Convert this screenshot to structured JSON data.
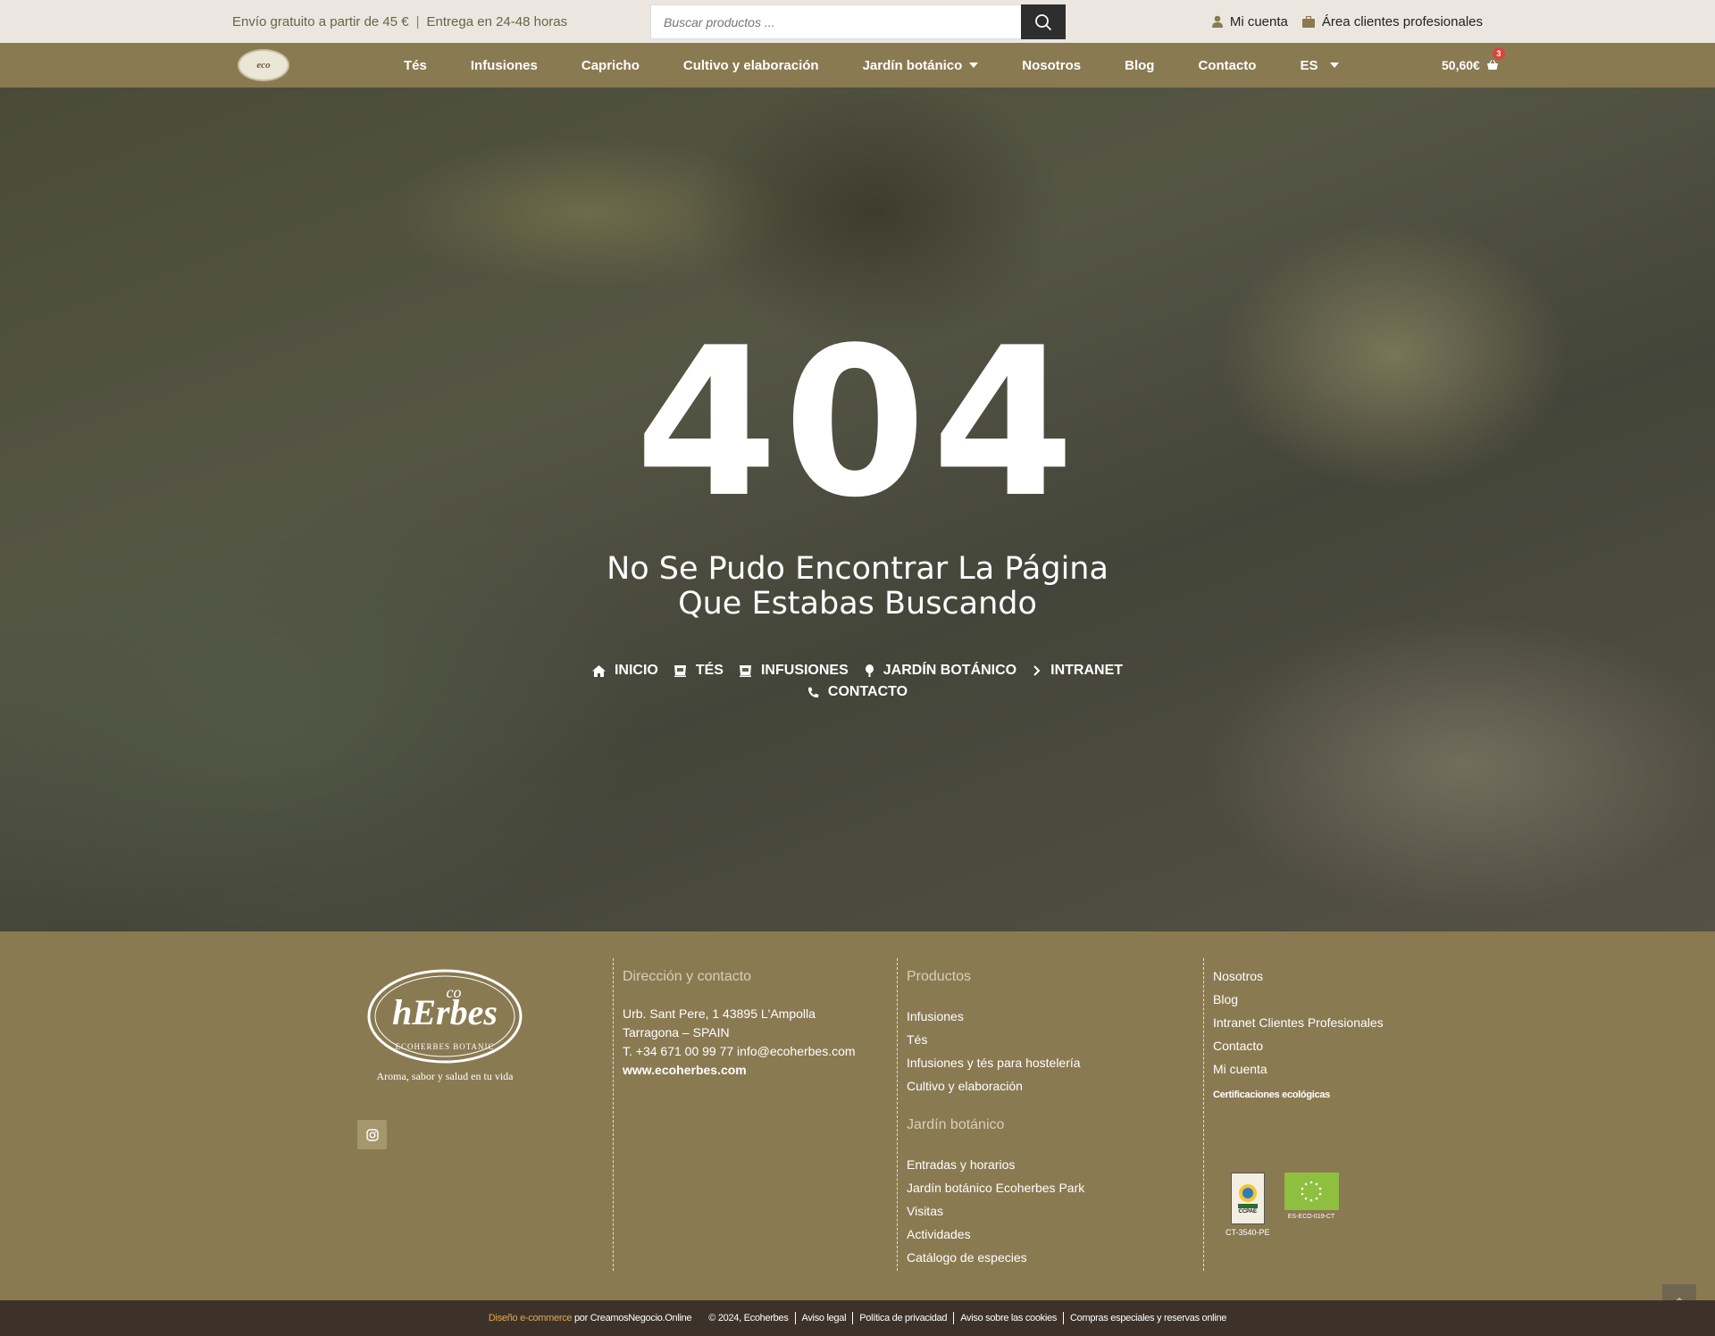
{
  "topbar": {
    "shipping_text": "Envío gratuito a partir de 45 €",
    "separator": "|",
    "delivery_text": "Entrega en 24-48 horas",
    "search_placeholder": "Buscar productos ...",
    "my_account": "Mi cuenta",
    "pro_area": "Área clientes profesionales"
  },
  "nav": {
    "items": [
      {
        "label": "Tés"
      },
      {
        "label": "Infusiones"
      },
      {
        "label": "Capricho"
      },
      {
        "label": "Cultivo y elaboración"
      },
      {
        "label": "Jardín botánico"
      },
      {
        "label": "Nosotros"
      },
      {
        "label": "Blog"
      },
      {
        "label": "Contacto"
      },
      {
        "label": "ES"
      }
    ],
    "cart_total": "50,60€",
    "cart_count": "3"
  },
  "hero": {
    "code": "404",
    "message": "No Se Pudo Encontrar La Página Que Estabas Buscando",
    "links": [
      {
        "label": "INICIO",
        "icon": "home-icon"
      },
      {
        "label": "TÉS",
        "icon": "cup-icon"
      },
      {
        "label": "INFUSIONES",
        "icon": "cup-icon"
      },
      {
        "label": "JARDÍN BOTÁNICO",
        "icon": "tree-icon"
      },
      {
        "label": "INTRANET",
        "icon": "chevron-right-icon"
      },
      {
        "label": "CONTACTO",
        "icon": "phone-icon"
      }
    ]
  },
  "footer": {
    "tagline": "Aroma, sabor y salud en tu vida",
    "contact": {
      "title": "Dirección y contacto",
      "address1": "Urb. Sant Pere, 1 43895 L'Ampolla",
      "address2": "Tarragona – SPAIN",
      "phone_email": "T. +34 671 00 99 77 info@ecoherbes.com",
      "website": "www.ecoherbes.com"
    },
    "products": {
      "title": "Productos",
      "links": [
        "Infusiones",
        "Tés",
        "Infusiones y tés para hostelería",
        "Cultivo y elaboración"
      ]
    },
    "garden": {
      "title": "Jardín botánico",
      "links": [
        "Entradas y horarios",
        "Jardín botánico Ecoherbes Park",
        "Visitas",
        "Actividades",
        "Catálogo de especies"
      ]
    },
    "misc": {
      "links": [
        "Nosotros",
        "Blog",
        "Intranet Clientes Profesionales",
        "Contacto",
        "Mi cuenta"
      ],
      "cert_title": "Certificaciones ecológicas",
      "cert1_label": "CT-3540-PE",
      "cert1_name": "CCPAE",
      "cert2_label": "ES-ECO-019-CT"
    }
  },
  "bottombar": {
    "design_text": "Diseño e-commerce",
    "by_text": " por CreamosNegocio.Online",
    "copyright": "© 2024, Ecoherbes",
    "legal": "Aviso legal",
    "privacy": "Política de privacidad",
    "cookies": "Aviso sobre las cookies",
    "special": "Compras especiales y reservas online"
  },
  "colors": {
    "brand": "#8a7a52",
    "topbar_bg": "#ebe7e0",
    "bottombar_bg": "#3d3229",
    "accent": "#e1a94c",
    "badge": "#d8453c"
  }
}
